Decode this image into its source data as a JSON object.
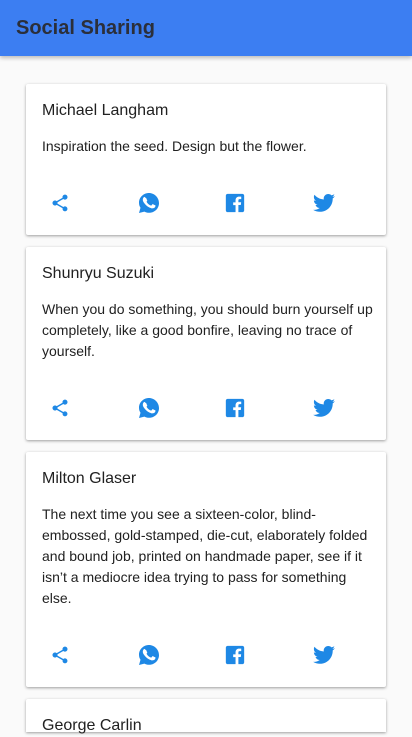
{
  "appbar": {
    "title": "Social Sharing"
  },
  "colors": {
    "appbar": "#3c7ef2",
    "icon": "#1e88e5",
    "card": "#ffffff",
    "background": "#fafafa"
  },
  "icons": [
    "share-icon",
    "whatsapp-icon",
    "facebook-icon",
    "twitter-icon"
  ],
  "quotes": [
    {
      "author": "Michael Langham",
      "text": "Inspiration the seed. Design but the flower."
    },
    {
      "author": "Shunryu Suzuki",
      "text": "When you do something, you should burn yourself up completely, like a good bonfire, leaving no trace of yourself."
    },
    {
      "author": "Milton Glaser",
      "text": "The next time you see a sixteen-color, blind-embossed, gold-stamped, die-cut, elaborately folded and bound job, printed on handmade paper, see if it isn’t a mediocre idea trying to pass for something else."
    },
    {
      "author": "George Carlin",
      "text": ""
    }
  ]
}
